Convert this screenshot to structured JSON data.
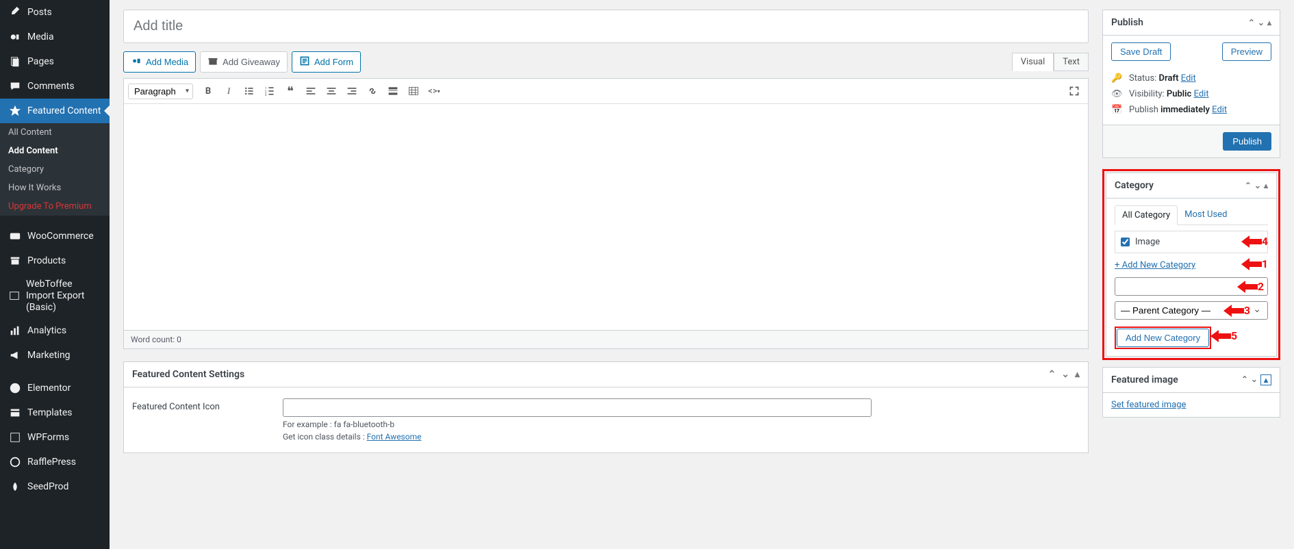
{
  "sidebar": {
    "items": [
      {
        "label": "Posts"
      },
      {
        "label": "Media"
      },
      {
        "label": "Pages"
      },
      {
        "label": "Comments"
      },
      {
        "label": "Featured Content"
      },
      {
        "label": "WooCommerce"
      },
      {
        "label": "Products"
      },
      {
        "label": "WebToffee Import Export (Basic)"
      },
      {
        "label": "Analytics"
      },
      {
        "label": "Marketing"
      },
      {
        "label": "Elementor"
      },
      {
        "label": "Templates"
      },
      {
        "label": "WPForms"
      },
      {
        "label": "RafflePress"
      },
      {
        "label": "SeedProd"
      }
    ],
    "subitems": [
      {
        "label": "All Content"
      },
      {
        "label": "Add Content"
      },
      {
        "label": "Category"
      },
      {
        "label": "How It Works"
      },
      {
        "label": "Upgrade To Premium"
      }
    ]
  },
  "editor": {
    "title_placeholder": "Add title",
    "add_media": "Add Media",
    "add_giveaway": "Add Giveaway",
    "add_form": "Add Form",
    "tab_visual": "Visual",
    "tab_text": "Text",
    "paragraph": "Paragraph",
    "word_count": "Word count: 0"
  },
  "settings": {
    "panel_title": "Featured Content Settings",
    "icon_label": "Featured Content Icon",
    "icon_help1": "For example : fa fa-bluetooth-b",
    "icon_help2": "Get icon class details : ",
    "icon_help_link": "Font Awesome"
  },
  "publish": {
    "title": "Publish",
    "save_draft": "Save Draft",
    "preview": "Preview",
    "status_label": "Status: ",
    "status_value": "Draft",
    "visibility_label": "Visibility: ",
    "visibility_value": "Public",
    "publish_label": "Publish ",
    "publish_value": "immediately",
    "edit": "Edit",
    "publish_btn": "Publish"
  },
  "category": {
    "title": "Category",
    "tab_all": "All Category",
    "tab_most": "Most Used",
    "item_image": "Image",
    "add_new_link": "+ Add New Category",
    "parent_placeholder": "— Parent Category —",
    "add_new_btn": "Add New Category"
  },
  "featured_image": {
    "title": "Featured image",
    "set_link": "Set featured image"
  },
  "annotations": {
    "a1": "1",
    "a2": "2",
    "a3": "3",
    "a4": "4",
    "a5": "5"
  }
}
